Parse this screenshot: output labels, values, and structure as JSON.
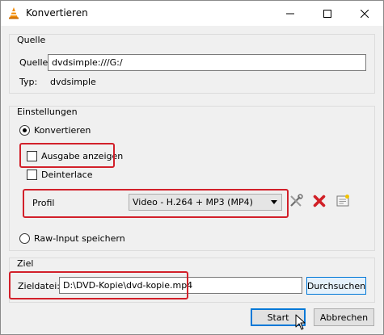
{
  "window": {
    "title": "Konvertieren",
    "controls": {
      "minimize": "—",
      "maximize": "☐",
      "close": "✕"
    }
  },
  "source": {
    "group_label": "Quelle",
    "source_label": "Quelle:",
    "source_value": "dvdsimple:///G:/",
    "type_label": "Typ:",
    "type_value": "dvdsimple"
  },
  "settings": {
    "group_label": "Einstellungen",
    "convert_label": "Konvertieren",
    "convert_checked": true,
    "show_output_label": "Ausgabe anzeigen",
    "show_output_checked": false,
    "deinterlace_label": "Deinterlace",
    "deinterlace_checked": false,
    "profile_label": "Profil",
    "profile_value": "Video - H.264 + MP3 (MP4)",
    "raw_input_label": "Raw-Input speichern",
    "raw_input_checked": false
  },
  "target": {
    "group_label": "Ziel",
    "file_label": "Zieldatei:",
    "file_value": "D:\\DVD-Kopie\\dvd-kopie.mp4",
    "browse_label": "Durchsuchen"
  },
  "footer": {
    "start_label": "Start",
    "cancel_label": "Abbrechen"
  },
  "colors": {
    "highlight": "#d2202a",
    "accent": "#0078d7",
    "delete_red": "#d11f26",
    "vlc_orange": "#f28a00"
  },
  "icons": [
    "vlc-cone-icon",
    "wrench-screwdriver-icon",
    "delete-x-icon",
    "new-profile-icon",
    "mouse-cursor-icon"
  ]
}
